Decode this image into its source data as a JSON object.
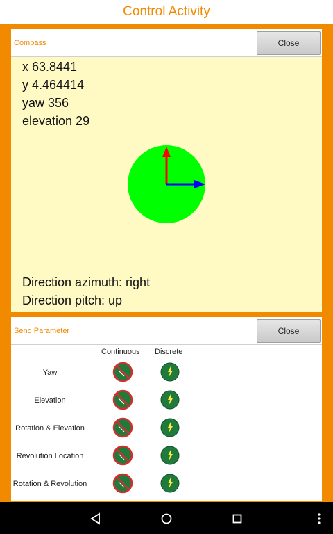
{
  "app": {
    "title": "Control Activity"
  },
  "compass": {
    "title": "Compass",
    "close_label": "Close",
    "x_text": "x 63.8441",
    "y_text": "y 4.464414",
    "yaw_text": "yaw  356",
    "elevation_text": "elevation  29",
    "azimuth_text": "Direction azimuth: right",
    "pitch_text": "Direction pitch: up",
    "colors": {
      "dial": "#00ff00",
      "up_arrow": "#ff0000",
      "right_arrow": "#0000ff"
    }
  },
  "send_parameter": {
    "title": "Send Parameter",
    "close_label": "Close",
    "columns": [
      "Continuous",
      "Discrete"
    ],
    "rows": [
      {
        "label": "Yaw",
        "continuous_icon": "disabled-icon",
        "discrete_icon": "enabled-icon"
      },
      {
        "label": "Elevation",
        "continuous_icon": "disabled-icon",
        "discrete_icon": "enabled-icon"
      },
      {
        "label": "Rotation & Elevation",
        "continuous_icon": "disabled-icon",
        "discrete_icon": "enabled-icon"
      },
      {
        "label": "Revolution Location",
        "continuous_icon": "disabled-icon",
        "discrete_icon": "enabled-icon"
      },
      {
        "label": "Rotation & Revolution",
        "continuous_icon": "disabled-icon",
        "discrete_icon": "enabled-icon"
      }
    ]
  },
  "navbar": {
    "buttons": [
      "back-icon",
      "home-icon",
      "recents-icon",
      "more-icon"
    ]
  }
}
